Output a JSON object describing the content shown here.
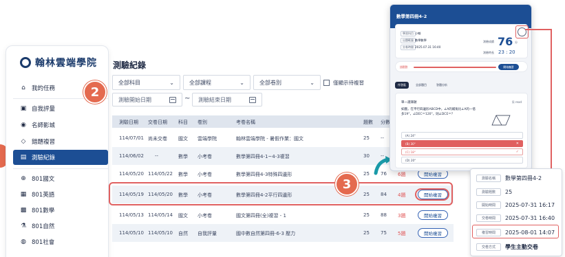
{
  "sidebar": {
    "brand": "翰林雲端學院",
    "items": [
      {
        "label": "我的任務",
        "icon": "home-icon"
      },
      {
        "label": "自我評量",
        "icon": "clipboard-icon"
      },
      {
        "label": "名師影城",
        "icon": "play-icon"
      },
      {
        "label": "錯題複習",
        "icon": "tag-icon"
      },
      {
        "label": "測驗紀錄",
        "icon": "record-icon",
        "active": true
      },
      {
        "label": "801國文",
        "icon": "book-icon"
      },
      {
        "label": "801英語",
        "icon": "book-open-icon"
      },
      {
        "label": "801數學",
        "icon": "grid-icon"
      },
      {
        "label": "801自然",
        "icon": "flask-icon"
      },
      {
        "label": "801社會",
        "icon": "globe-icon"
      }
    ]
  },
  "main": {
    "title": "測驗紀錄",
    "filters": {
      "subject": "全部科目",
      "course": "全部課程",
      "volume": "全部卷別",
      "start_date": "測驗開始日期",
      "end_date": "測驗結束日期",
      "tilde": "~",
      "pending_only": "僅顯示待複習"
    },
    "columns": [
      "測驗日期",
      "交卷日期",
      "科目",
      "卷別",
      "考卷名稱",
      "題數",
      "分數"
    ],
    "rows": [
      {
        "test_date": "114/07/01",
        "submit_date": "尚未交卷",
        "subject": "國文",
        "type": "雲端學院",
        "name": "翰林雲端學院 - 暑假作業：國文",
        "count": "25",
        "score": "--",
        "wrong": "",
        "action": ""
      },
      {
        "test_date": "114/06/02",
        "submit_date": "--",
        "subject": "數學",
        "type": "小考卷",
        "name": "數學第四冊4-1~4-3複習",
        "count": "30",
        "score": "--",
        "wrong": "",
        "action": ""
      },
      {
        "test_date": "114/05/20",
        "submit_date": "114/05/22",
        "subject": "數學",
        "type": "小考卷",
        "name": "數學第四冊4-3特殊四邊形",
        "count": "25",
        "score": "76",
        "wrong": "6題",
        "action": "開始複習"
      },
      {
        "test_date": "114/05/19",
        "submit_date": "114/05/20",
        "subject": "數學",
        "type": "小考卷",
        "name": "數學第四冊4-2平行四邊形",
        "count": "25",
        "score": "84",
        "wrong": "4題",
        "action": "開始複習"
      },
      {
        "test_date": "114/05/13",
        "submit_date": "114/05/14",
        "subject": "國文",
        "type": "小考卷",
        "name": "國文第四冊(全)複習 - 1",
        "count": "25",
        "score": "88",
        "wrong": "3題",
        "action": "開始複習"
      },
      {
        "test_date": "114/05/10",
        "submit_date": "114/05/10",
        "subject": "自然",
        "type": "自我評量",
        "name": "國中數自然第四冊-6-3 壓力",
        "count": "25",
        "score": "75",
        "wrong": "5題",
        "action": "開始複習"
      }
    ]
  },
  "badges": [
    "2",
    "3"
  ],
  "phone": {
    "title": "數學第四冊4-2",
    "info": [
      {
        "label": "學習科目",
        "value": "小翰"
      },
      {
        "label": "出題範圍",
        "value": "數學數學"
      },
      {
        "label": "交卷時間",
        "value": "2025.07.31 16:40"
      }
    ],
    "score_label": "測驗成績",
    "score": "76",
    "score_unit": "分",
    "duration_label": "測驗時長",
    "duration": "23 : 20",
    "progress_label": "錯題數",
    "progress_btn": "開始複習",
    "tabs": [
      "作答區",
      "全部題目",
      "答題分析"
    ],
    "question_head": "單一選擇題",
    "question_right": "另 read",
    "question_text": "如圖，在平行四邊形ABCD中，∠A的補角比∠A的一倍多19°，∠DEC＝120°，則∠DCE＝？",
    "options": [
      {
        "label": "(A) 24°",
        "state": ""
      },
      {
        "label": "(B) 30°",
        "state": "wrong",
        "mark": "✕"
      },
      {
        "label": "(C) 18°",
        "state": "right",
        "mark": "✓"
      },
      {
        "label": "(D) 20°",
        "state": ""
      }
    ]
  },
  "popup": {
    "rows": [
      {
        "label": "測驗名稱",
        "value": "數學第四冊4-2"
      },
      {
        "label": "測驗題數",
        "value": "25"
      },
      {
        "label": "開始時間",
        "value": "2025-07-31 16:17"
      },
      {
        "label": "交卷時間",
        "value": "2025-07-31 16:40"
      },
      {
        "label": "複習時間",
        "value": "2025-08-01 14:07"
      },
      {
        "label": "交卷方式",
        "value": "學生主動交卷"
      }
    ]
  },
  "colors": {
    "brand": "#1c4e94",
    "accent": "#e46a4f",
    "highlight": "#e06060"
  }
}
